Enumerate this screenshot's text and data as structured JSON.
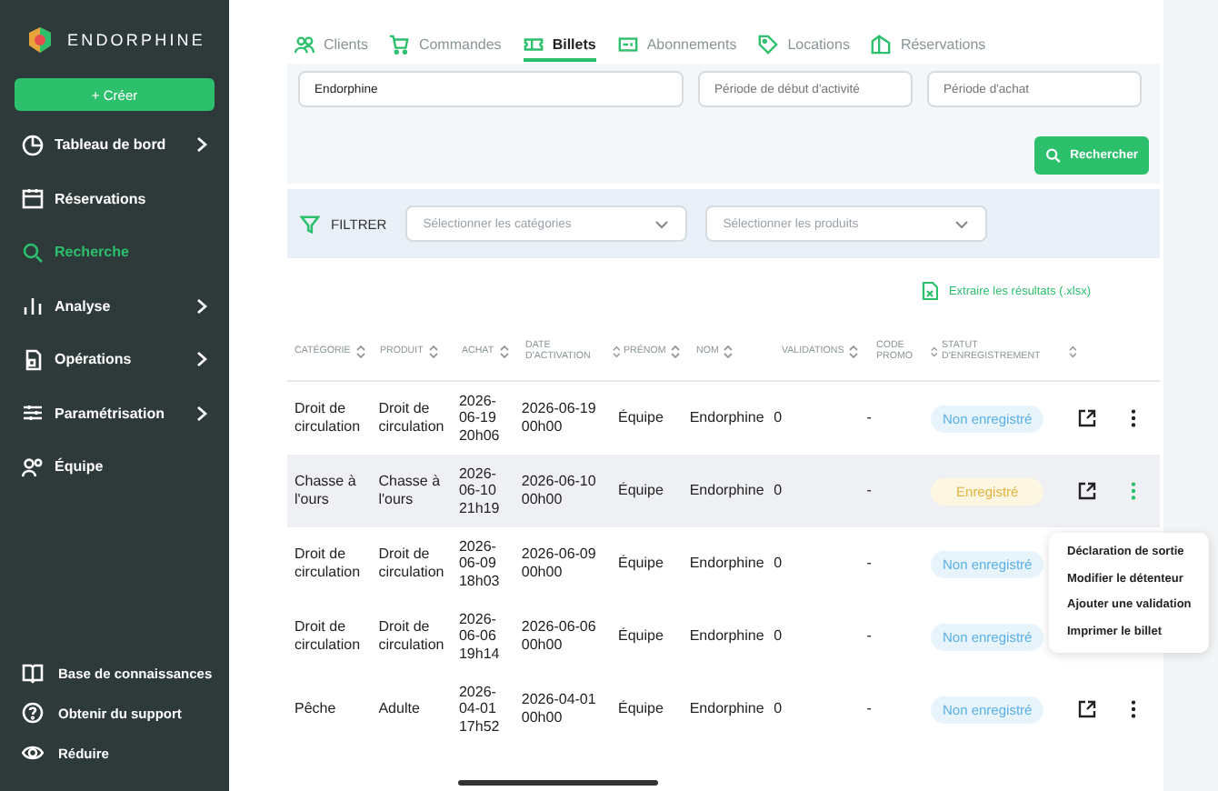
{
  "sidebar": {
    "brand": "ENDORPHINE",
    "create_button": "+ Créer",
    "items": [
      {
        "label": "Tableau de bord",
        "has_submenu": true,
        "selected": false
      },
      {
        "label": "Réservations",
        "has_submenu": false,
        "selected": false
      },
      {
        "label": "Recherche",
        "has_submenu": false,
        "selected": true
      },
      {
        "label": "Analyse",
        "has_submenu": true,
        "selected": false
      },
      {
        "label": "Opérations",
        "has_submenu": true,
        "selected": false
      },
      {
        "label": "Paramétrisation",
        "has_submenu": true,
        "selected": false
      },
      {
        "label": "Équipe",
        "has_submenu": false,
        "selected": false
      }
    ],
    "footer": [
      {
        "label": "Base de connaissances"
      },
      {
        "label": "Obtenir du support"
      },
      {
        "label": "Réduire"
      }
    ]
  },
  "tabs": [
    {
      "label": "Clients",
      "selected": false
    },
    {
      "label": "Commandes",
      "selected": false
    },
    {
      "label": "Billets",
      "selected": true
    },
    {
      "label": "Abonnements",
      "selected": false
    },
    {
      "label": "Locations",
      "selected": false
    },
    {
      "label": "Réservations",
      "selected": false
    }
  ],
  "search": {
    "name_value": "Endorphine",
    "activity_period_placeholder": "Période de début d'activité",
    "purchase_period_placeholder": "Période d'achat",
    "search_button": "Rechercher"
  },
  "filter": {
    "label": "FILTRER",
    "categories_placeholder": "Sélectionner les catégories",
    "products_placeholder": "Sélectionner les produits"
  },
  "export_link": "Extraire les résultats (.xlsx)",
  "table": {
    "columns": [
      "CATÉGORIE",
      "PRODUIT",
      "ACHAT",
      "DATE D'ACTIVATION",
      "PRÉNOM",
      "NOM",
      "VALIDATIONS",
      "CODE PROMO",
      "STATUT D'ENREGISTREMENT"
    ],
    "rows": [
      {
        "cells": [
          "Droit de circulation",
          "Droit de circulation",
          "2026-06-19 20h06",
          "2026-06-19 00h00",
          "Équipe",
          "Endorphine",
          "0",
          "-"
        ],
        "status": "Non enregistré",
        "kind": "unregistered",
        "highlighted": false
      },
      {
        "cells": [
          "Chasse à l'ours",
          "Chasse à l'ours",
          "2026-06-10 21h19",
          "2026-06-10 00h00",
          "Équipe",
          "Endorphine",
          "0",
          "-"
        ],
        "status": "Enregistré",
        "kind": "registered",
        "highlighted": true,
        "menu_open": true
      },
      {
        "cells": [
          "Droit de circulation",
          "Droit de circulation",
          "2026-06-09 18h03",
          "2026-06-09 00h00",
          "Équipe",
          "Endorphine",
          "0",
          "-"
        ],
        "status": "Non enregistré",
        "kind": "unregistered",
        "highlighted": false
      },
      {
        "cells": [
          "Droit de circulation",
          "Droit de circulation",
          "2026-06-06 19h14",
          "2026-06-06 00h00",
          "Équipe",
          "Endorphine",
          "0",
          "-"
        ],
        "status": "Non enregistré",
        "kind": "unregistered",
        "highlighted": false
      },
      {
        "cells": [
          "Pêche",
          "Adulte",
          "2026-04-01 17h52",
          "2026-04-01 00h00",
          "Équipe",
          "Endorphine",
          "0",
          "-"
        ],
        "status": "Non enregistré",
        "kind": "unregistered",
        "highlighted": false
      }
    ]
  },
  "row_menu": [
    "Déclaration de sortie",
    "Modifier le détenteur",
    "Ajouter une validation",
    "Imprimer le billet"
  ]
}
